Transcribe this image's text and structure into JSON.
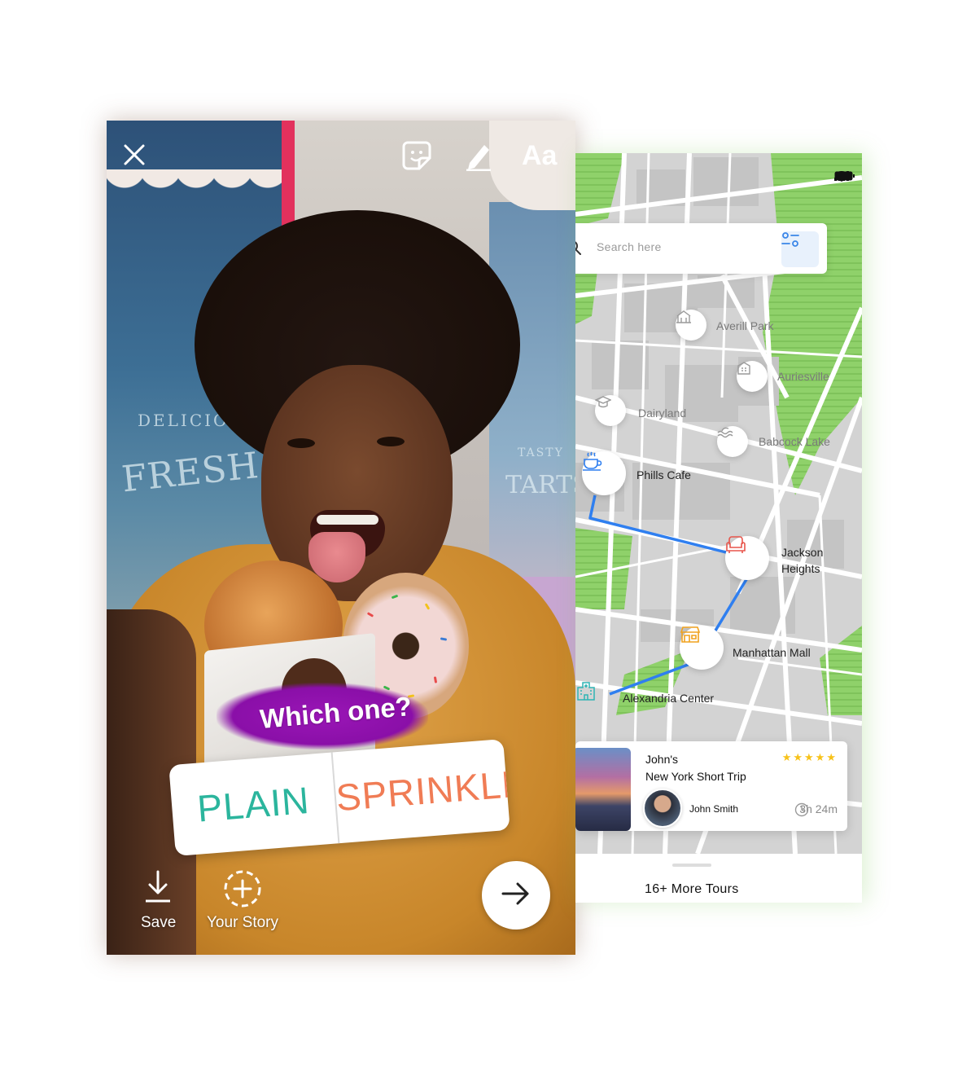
{
  "story": {
    "top_icons": [
      "close-icon",
      "sticker-icon",
      "draw-icon"
    ],
    "text_tool_label": "Aa",
    "poll": {
      "question": "Which one?",
      "options": [
        "PLAIN",
        "SPRINKLES"
      ],
      "option_colors": [
        "#2bb59d",
        "#f07c55"
      ]
    },
    "actions": {
      "save_label": "Save",
      "your_story_label": "Your Story"
    },
    "background_text": {
      "line1": "DELICIO",
      "line2": "FRESH PIES",
      "line3": "TASTY",
      "line4": "TARTS"
    }
  },
  "map_app": {
    "search": {
      "placeholder": "Search here"
    },
    "places": [
      {
        "name": "Averill Park",
        "icon": "landmark-icon",
        "style": "faded"
      },
      {
        "name": "Auriesville",
        "icon": "building-icon",
        "style": "faded"
      },
      {
        "name": "Dairyland",
        "icon": "graduation-cap-icon",
        "style": "faded"
      },
      {
        "name": "Babcock Lake",
        "icon": "waves-icon",
        "style": "faded"
      },
      {
        "name": "Phills Cafe",
        "icon": "coffee-icon",
        "style": "active"
      },
      {
        "name": "Jackson Heights",
        "icon": "armchair-icon",
        "style": "active"
      },
      {
        "name": "Manhattan Mall",
        "icon": "store-icon",
        "style": "active"
      },
      {
        "name": "Alexandria Center",
        "icon": "hospital-icon",
        "style": "active"
      }
    ],
    "jackson_line1": "Jackson",
    "jackson_line2": "Heights",
    "tour": {
      "owner": "John's",
      "title": "New York Short Trip",
      "rating": "★★★★★",
      "author": "John Smith",
      "duration": "3h 24m"
    },
    "more_tours": "16+ More Tours",
    "colors": {
      "route": "#2f7ff0",
      "park": "#8fd16a",
      "accent_blue": "#3a86e8",
      "cafe_blue": "#2f7ff0",
      "red": "#e8554b",
      "orange": "#f0a21e",
      "teal": "#2fb4b4"
    }
  }
}
